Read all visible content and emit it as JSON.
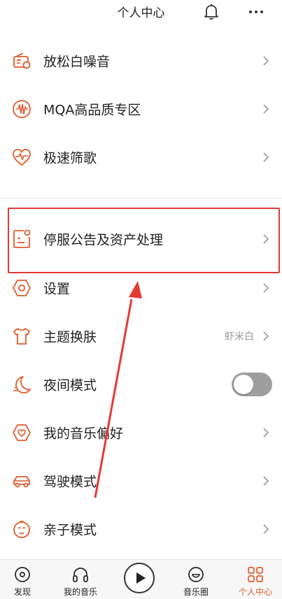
{
  "header": {
    "title": "个人中心",
    "bell_icon": "bell-icon",
    "more_icon": "more-dots-icon"
  },
  "colors": {
    "accent": "#e05a2a",
    "highlight_border": "#e53935",
    "toggle_off": "#9e9e9e"
  },
  "menu": {
    "relax_noise": {
      "label": "放松白噪音",
      "icon": "radio-icon"
    },
    "mqa": {
      "label": "MQA高品质专区",
      "icon": "waveform-icon"
    },
    "quick_filter": {
      "label": "极速筛歌",
      "icon": "heart-pulse-icon"
    },
    "service_notice": {
      "label": "停服公告及资产处理",
      "icon": "notice-document-icon"
    },
    "settings": {
      "label": "设置",
      "icon": "hexagon-settings-icon"
    },
    "theme": {
      "label": "主题换肤",
      "value": "虾米白",
      "icon": "tshirt-icon"
    },
    "night_mode": {
      "label": "夜间模式",
      "icon": "moon-icon",
      "toggle": false
    },
    "music_pref": {
      "label": "我的音乐偏好",
      "icon": "heart-tag-icon"
    },
    "drive_mode": {
      "label": "驾驶模式",
      "icon": "car-icon"
    },
    "kids_mode": {
      "label": "亲子模式",
      "icon": "baby-face-icon"
    }
  },
  "tabbar": {
    "discover": {
      "label": "发现",
      "icon": "disc-icon"
    },
    "my_music": {
      "label": "我的音乐",
      "icon": "headphones-icon"
    },
    "play": {
      "icon": "play-icon"
    },
    "music_circle": {
      "label": "音乐圈",
      "icon": "smile-icon"
    },
    "profile": {
      "label": "个人中心",
      "icon": "grid-icon",
      "active": true
    }
  }
}
